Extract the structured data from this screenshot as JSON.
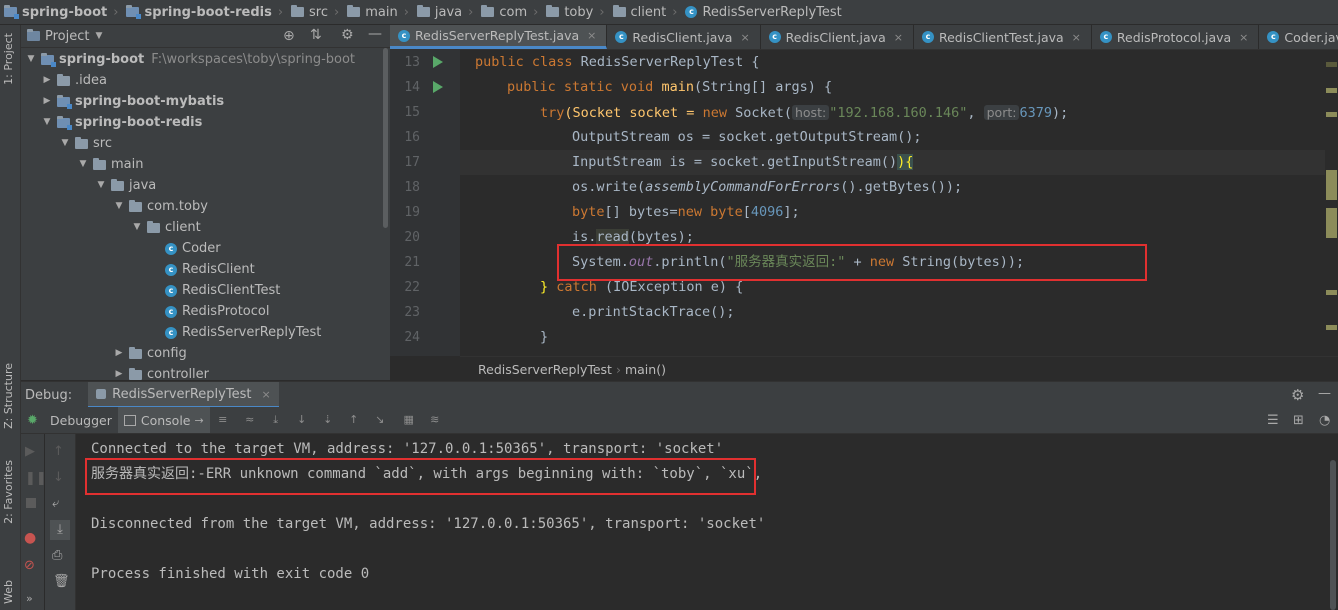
{
  "breadcrumb": [
    "spring-boot",
    "spring-boot-redis",
    "src",
    "main",
    "java",
    "com",
    "toby",
    "client",
    "RedisServerReplyTest"
  ],
  "left_strip": {
    "project_label": "1: Project",
    "structure_label": "Z: Structure",
    "favorites_label": "2: Favorites",
    "web_label": "Web"
  },
  "project": {
    "header": "Project",
    "tree": [
      {
        "label": "spring-boot",
        "extra": "F:\\workspaces\\toby\\spring-boot",
        "kind": "module",
        "arrow": "▼"
      },
      {
        "label": ".idea",
        "kind": "folder",
        "arrow": "▶"
      },
      {
        "label": "spring-boot-mybatis",
        "kind": "module",
        "arrow": "▶"
      },
      {
        "label": "spring-boot-redis",
        "kind": "module",
        "arrow": "▼"
      },
      {
        "label": "src",
        "kind": "folder",
        "arrow": "▼"
      },
      {
        "label": "main",
        "kind": "folder",
        "arrow": "▼"
      },
      {
        "label": "java",
        "kind": "folder",
        "arrow": "▼"
      },
      {
        "label": "com.toby",
        "kind": "folder",
        "arrow": "▼"
      },
      {
        "label": "client",
        "kind": "folder",
        "arrow": "▼"
      },
      {
        "label": "Coder",
        "kind": "class",
        "arrow": ""
      },
      {
        "label": "RedisClient",
        "kind": "class",
        "arrow": ""
      },
      {
        "label": "RedisClientTest",
        "kind": "class",
        "arrow": ""
      },
      {
        "label": "RedisProtocol",
        "kind": "class",
        "arrow": ""
      },
      {
        "label": "RedisServerReplyTest",
        "kind": "class",
        "arrow": ""
      },
      {
        "label": "config",
        "kind": "folder",
        "arrow": "▶"
      },
      {
        "label": "controller",
        "kind": "folder",
        "arrow": "▶"
      }
    ]
  },
  "tabs": [
    {
      "label": "RedisServerReplyTest.java",
      "active": true
    },
    {
      "label": "RedisClient.java",
      "active": false
    },
    {
      "label": "RedisClient.java",
      "active": false
    },
    {
      "label": "RedisClientTest.java",
      "active": false
    },
    {
      "label": "RedisProtocol.java",
      "active": false
    },
    {
      "label": "Coder.java",
      "active": false
    }
  ],
  "tabs_overflow": "≡",
  "line_numbers": [
    "13",
    "14",
    "15",
    "16",
    "17",
    "18",
    "19",
    "20",
    "21",
    "22",
    "23",
    "24"
  ],
  "code": {
    "l13": {
      "kw1": "public class ",
      "name": "RedisServerReplyTest",
      "rest": " {"
    },
    "l14": {
      "kw1": "public static void ",
      "fn": "main",
      "rest": "(String[] args) {"
    },
    "l15": {
      "kw1": "try",
      "p1": "(Socket socket = ",
      "kw2": "new ",
      "p2": "Socket(",
      "hint1": "host:",
      "str": "\"192.168.160.146\"",
      "p3": ", ",
      "hint2": "port:",
      "num": "6379",
      "p4": ");"
    },
    "l16": {
      "text": "OutputStream os = socket.getOutputStream();"
    },
    "l17": {
      "text": "InputStream is = socket.getInputStream()",
      "tail": "){"
    },
    "l18": {
      "p1": "os.write(",
      "it": "assemblyCommandForErrors",
      "p2": "().getBytes());"
    },
    "l19": {
      "kw1": "byte",
      "p1": "[] bytes=",
      "kw2": "new byte",
      "p2": "[",
      "num": "4096",
      "p3": "];"
    },
    "l20": {
      "p1": "is.",
      "ul": "read",
      "p2": "(bytes);"
    },
    "l21": {
      "p1": "System.",
      "st": "out",
      "p2": ".println(",
      "str": "\"服务器真实返回:\"",
      "p3": " + ",
      "kw": "new ",
      "p4": "String(bytes));"
    },
    "l22": {
      "p1": "} ",
      "kw": "catch ",
      "p2": "(IOException e) {"
    },
    "l23": {
      "text": "e.printStackTrace();"
    },
    "l24": {
      "text": "}"
    }
  },
  "editor_breadcrumb": {
    "cls": "RedisServerReplyTest",
    "method": "main()"
  },
  "debug": {
    "title": "Debug:",
    "config": "RedisServerReplyTest",
    "tab_debugger": "Debugger",
    "tab_console": "Console",
    "console_lines": [
      "Connected to the target VM, address: '127.0.0.1:50365', transport: 'socket'",
      "服务器真实返回:-ERR unknown command `add`, with args beginning with: `toby`, `xu`,",
      "",
      "Disconnected from the target VM, address: '127.0.0.1:50365', transport: 'socket'",
      "",
      "Process finished with exit code 0"
    ]
  },
  "colors": {
    "highlight_box": "#e13030",
    "accent": "#4a88c7",
    "run_icon": "#59a869"
  }
}
